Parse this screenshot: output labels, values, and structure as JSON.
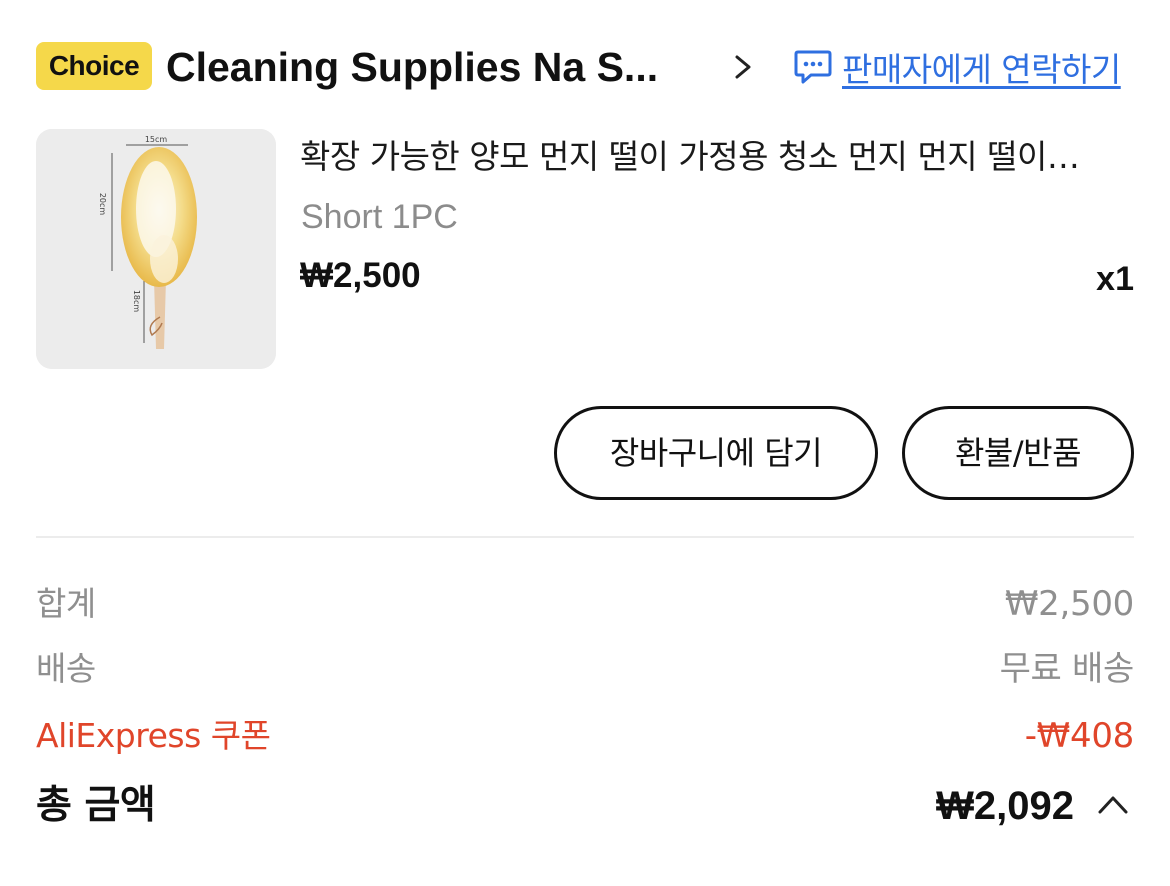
{
  "header": {
    "badge": "Choice",
    "store_name": "Cleaning Supplies Na S...",
    "contact_seller": "판매자에게 연락하기"
  },
  "product": {
    "title": "확장 가능한 양모 먼지 떨이 가정용 청소 먼지 먼지 떨이…",
    "variant": "Short 1PC",
    "price": "₩2,500",
    "quantity": "x1",
    "image_labels": {
      "width": "15cm",
      "head_length": "20cm",
      "handle_length": "18cm"
    }
  },
  "actions": {
    "add_to_cart": "장바구니에 담기",
    "refund_return": "환불/반품"
  },
  "summary": {
    "subtotal_label": "합계",
    "subtotal_value": "₩2,500",
    "shipping_label": "배송",
    "shipping_value": "무료 배송",
    "coupon_label": "AliExpress 쿠폰",
    "coupon_value": "-₩408",
    "total_label": "총 금액",
    "total_value": "₩2,092"
  },
  "colors": {
    "choice_badge": "#f5d84a",
    "link_blue": "#2f6fe0",
    "discount_red": "#e0452a"
  },
  "icons": {
    "store_chevron": "chevron-right-icon",
    "contact": "chat-bubble-icon",
    "total_toggle": "chevron-up-icon"
  }
}
